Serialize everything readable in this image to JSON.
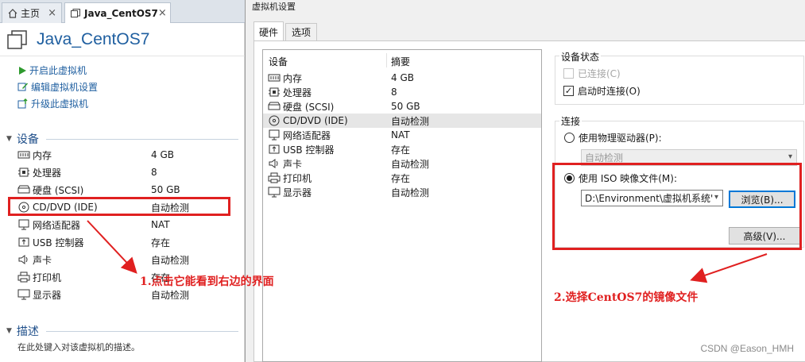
{
  "tabs": [
    {
      "label": "主页",
      "icon": "home-icon"
    },
    {
      "label": "Java_CentOS7",
      "icon": "vm-icon"
    }
  ],
  "vm_name": "Java_CentOS7",
  "actions": [
    {
      "label": "开启此虚拟机",
      "icon": "play-icon"
    },
    {
      "label": "编辑虚拟机设置",
      "icon": "edit-icon"
    },
    {
      "label": "升级此虚拟机",
      "icon": "upgrade-icon"
    }
  ],
  "devices_section": "设备",
  "devices": [
    {
      "name": "内存",
      "value": "4 GB",
      "icon": "memory-icon"
    },
    {
      "name": "处理器",
      "value": "8",
      "icon": "cpu-icon"
    },
    {
      "name": "硬盘 (SCSI)",
      "value": "50 GB",
      "icon": "disk-icon"
    },
    {
      "name": "CD/DVD (IDE)",
      "value": "自动检测",
      "icon": "cd-icon"
    },
    {
      "name": "网络适配器",
      "value": "NAT",
      "icon": "network-icon"
    },
    {
      "name": "USB 控制器",
      "value": "存在",
      "icon": "usb-icon"
    },
    {
      "name": "声卡",
      "value": "自动检测",
      "icon": "sound-icon"
    },
    {
      "name": "打印机",
      "value": "存在",
      "icon": "printer-icon"
    },
    {
      "name": "显示器",
      "value": "自动检测",
      "icon": "monitor-icon"
    }
  ],
  "description_section": "描述",
  "description_placeholder": "在此处键入对该虚拟机的描述。",
  "dialog": {
    "title": "虚拟机设置",
    "tabs": [
      "硬件",
      "选项"
    ],
    "columns": {
      "device": "设备",
      "summary": "摘要"
    },
    "selected_device": "CD/DVD (IDE)",
    "device_status": {
      "label": "设备状态",
      "connected": {
        "label": "已连接(C)",
        "checked": false,
        "enabled": false
      },
      "connect_on_start": {
        "label": "启动时连接(O)",
        "checked": true,
        "enabled": true
      }
    },
    "connection": {
      "label": "连接",
      "physical": {
        "label": "使用物理驱动器(P):",
        "selected": false,
        "value": "自动检测"
      },
      "iso": {
        "label": "使用 ISO 映像文件(M):",
        "selected": true,
        "value": "D:\\Environment\\虚拟机系统'"
      },
      "browse_label": "浏览(B)...",
      "advanced_label": "高级(V)..."
    }
  },
  "annotations": {
    "note1": "1.点击它能看到右边的界面",
    "note2": "2.选择CentOS7的镜像文件",
    "color": "#e02020"
  },
  "watermark": "CSDN @Eason_HMH"
}
